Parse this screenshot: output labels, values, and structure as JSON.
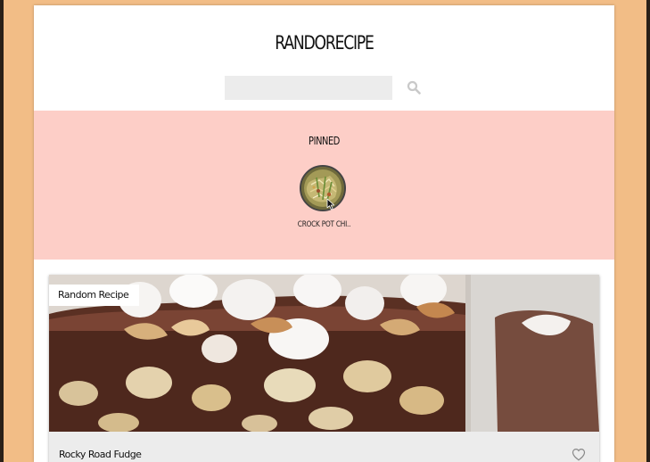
{
  "app": {
    "title": "RANDORECIPE",
    "colors": {
      "page_background": "#f2bd86",
      "pinned_background": "#fdcec7",
      "search_background": "#ececec",
      "card_footer": "#ececec"
    }
  },
  "search": {
    "value": "",
    "placeholder": "",
    "icon": "search-icon"
  },
  "pinned": {
    "title": "PINNED",
    "items": [
      {
        "label": "CROCK POT CHI..",
        "thumbnail": "pinned-recipe-thumbnail"
      }
    ]
  },
  "recipe_card": {
    "tag": "Random Recipe",
    "title": "Rocky Road Fudge",
    "favorite_icon": "heart-outline-icon"
  }
}
